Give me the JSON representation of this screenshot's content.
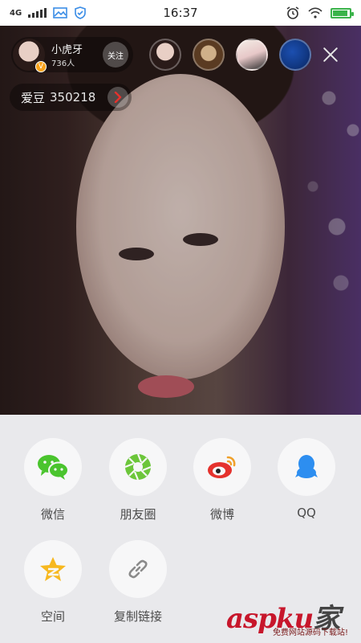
{
  "status_bar": {
    "network": "4G",
    "time": "16:37",
    "battery_level": 0.9
  },
  "live": {
    "host": {
      "name": "小虎牙",
      "viewers": "736人",
      "follow_label": "关注"
    },
    "idol": {
      "label": "爱豆",
      "value": "350218"
    }
  },
  "share_sheet": {
    "items": [
      {
        "label": "微信",
        "icon": "wechat-icon"
      },
      {
        "label": "朋友圈",
        "icon": "moments-icon"
      },
      {
        "label": "微博",
        "icon": "weibo-icon"
      },
      {
        "label": "QQ",
        "icon": "qq-icon"
      },
      {
        "label": "空间",
        "icon": "qzone-icon"
      },
      {
        "label": "复制链接",
        "icon": "link-icon"
      }
    ]
  },
  "watermark": {
    "brand": "aspku",
    "suffix": "家",
    "tagline": "免费网站源码下载站!"
  },
  "colors": {
    "wechat": "#4ac42e",
    "moments": "#6cc63a",
    "weibo": "#e5322d",
    "qq": "#2d8ef0",
    "qzone": "#f7b81f",
    "link": "#8a8a8a"
  }
}
